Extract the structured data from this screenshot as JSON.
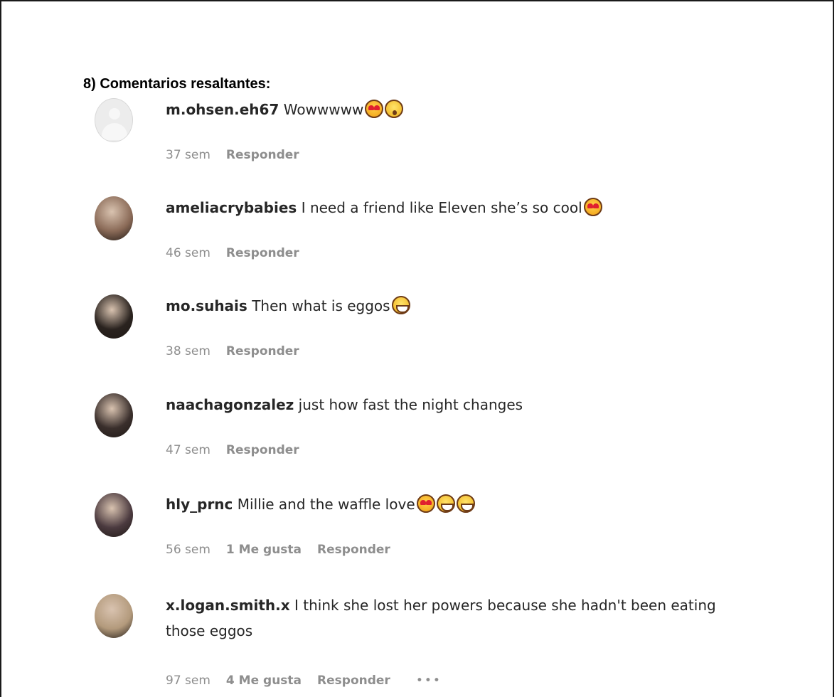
{
  "section_title": "8) Comentarios resaltantes:",
  "reply_label": "Responder",
  "more_label": "•••",
  "comments": [
    {
      "user": "m.ohsen.eh67",
      "text": "Wowwwww",
      "emojis": [
        "heart-eyes",
        "surprised"
      ],
      "time": "37 sem",
      "likes": "",
      "avatar": {
        "kind": "default",
        "color": "#ececec"
      }
    },
    {
      "user": "ameliacrybabies",
      "text": "I need a friend like Eleven she’s so cool",
      "emojis": [
        "heart-eyes"
      ],
      "time": "46 sem",
      "likes": "",
      "avatar": {
        "kind": "photo",
        "color": "#8a6a57"
      }
    },
    {
      "user": "mo.suhais",
      "text": "Then what is eggos",
      "emojis": [
        "laugh"
      ],
      "time": "38 sem",
      "likes": "",
      "avatar": {
        "kind": "photo",
        "color": "#2a231f"
      }
    },
    {
      "user": "naachagonzalez",
      "text": "just how fast the night changes",
      "emojis": [],
      "time": "47 sem",
      "likes": "",
      "avatar": {
        "kind": "photo",
        "color": "#3a2f2c"
      }
    },
    {
      "user": "hly_prnc",
      "text": "Millie and the waffle love",
      "emojis": [
        "heart-eyes",
        "laugh",
        "laugh"
      ],
      "time": "56 sem",
      "likes": "1 Me gusta",
      "avatar": {
        "kind": "photo",
        "color": "#4b3a3f"
      }
    },
    {
      "user": "x.logan.smith.x",
      "text": "I think she lost her powers because she hadn't been eating those eggos",
      "emojis": [],
      "time": "97 sem",
      "likes": "4 Me gusta",
      "more": true,
      "avatar": {
        "kind": "photo",
        "color": "#b39a7c"
      }
    }
  ]
}
